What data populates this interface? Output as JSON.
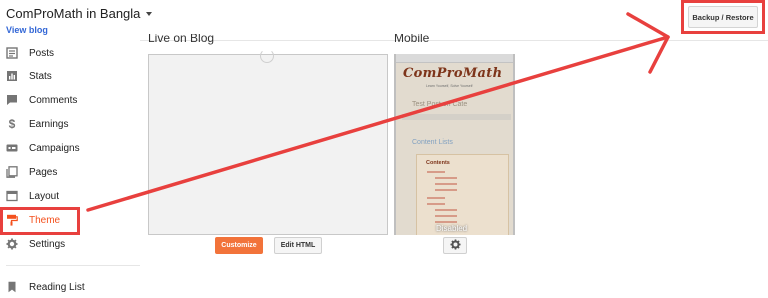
{
  "header": {
    "blog_title": "ComProMath in Bangla",
    "view_blog": "View blog",
    "backup_restore": "Backup / Restore"
  },
  "sidebar": {
    "items": [
      {
        "label": "Posts",
        "icon": "posts-icon"
      },
      {
        "label": "Stats",
        "icon": "stats-icon"
      },
      {
        "label": "Comments",
        "icon": "comments-icon"
      },
      {
        "label": "Earnings",
        "icon": "dollar-icon"
      },
      {
        "label": "Campaigns",
        "icon": "campaigns-icon"
      },
      {
        "label": "Pages",
        "icon": "pages-icon"
      },
      {
        "label": "Layout",
        "icon": "layout-icon"
      },
      {
        "label": "Theme",
        "icon": "paint-roller-icon",
        "active": true
      },
      {
        "label": "Settings",
        "icon": "gear-icon"
      },
      {
        "label": "Reading List",
        "icon": "bookmark-icon"
      }
    ]
  },
  "main": {
    "live_label": "Live on Blog",
    "mobile_label": "Mobile",
    "customize": "Customize",
    "edit_html": "Edit HTML",
    "mobile_preview": {
      "brand": "ComProMath",
      "tagline": "Learn Yourself, Solve Yourself",
      "post_title": "Test Post on Cate",
      "section_title": "Content Lists",
      "toc_heading": "Contents",
      "overlay": "Disabled"
    }
  },
  "colors": {
    "accent": "#f2733a",
    "active_nav": "#f4511e",
    "annotation": "#e8403e",
    "link": "#3367d6"
  }
}
